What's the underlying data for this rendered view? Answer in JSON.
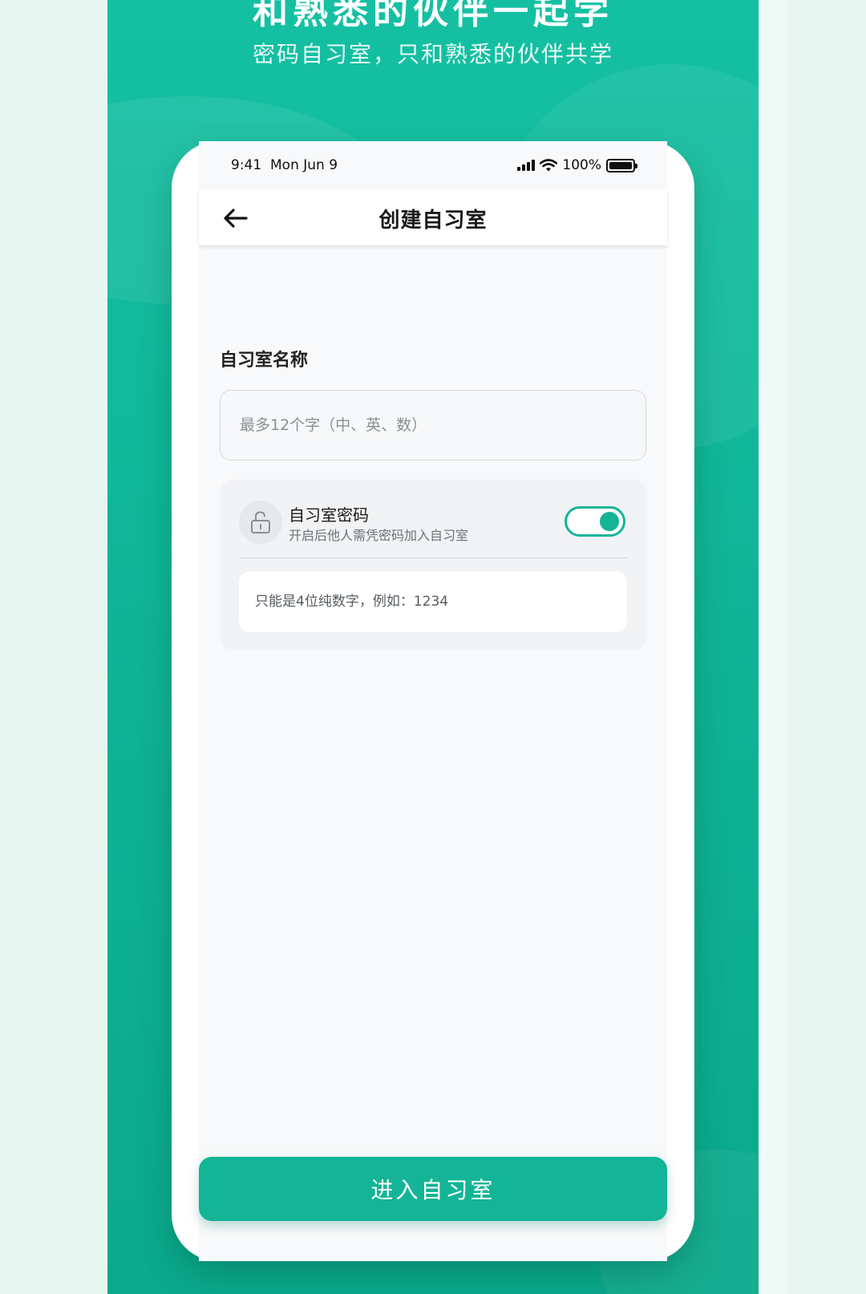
{
  "promo": {
    "headline": "和熟悉的伙伴一起学",
    "subline": "密码自习室，只和熟悉的伙伴共学"
  },
  "status_bar": {
    "time": "9:41",
    "date": "Mon Jun 9",
    "battery": "100%"
  },
  "nav": {
    "title": "创建自习室",
    "back_icon": "arrow-left-icon"
  },
  "form": {
    "name_label": "自习室名称",
    "name_value": "",
    "name_placeholder": "最多12个字（中、英、数）",
    "password_title": "自习室密码",
    "password_desc": "开启后他人需凭密码加入自习室",
    "password_enabled": true,
    "password_value": "",
    "password_placeholder": "只能是4位纯数字，例如：1234",
    "lock_icon": "unlock-icon"
  },
  "actions": {
    "submit_label": "进入自习室"
  },
  "colors": {
    "accent": "#13b596",
    "promo_bg": "#12b89a",
    "side_bg": "#e8f6f2"
  }
}
